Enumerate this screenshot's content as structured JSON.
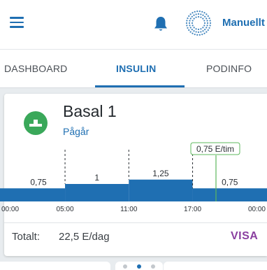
{
  "header": {
    "menu_icon": "hamburger-menu-icon",
    "notification_icon": "bell-icon",
    "mode_icon": "manual-mode-ring-icon",
    "mode_label": "Manuellt"
  },
  "tabs": [
    {
      "label": "DASHBOARD",
      "active": false
    },
    {
      "label": "INSULIN",
      "active": true
    },
    {
      "label": "PODINFO",
      "active": false
    }
  ],
  "basal": {
    "icon": "basal-program-icon",
    "title": "Basal 1",
    "status": "Pågår",
    "current_rate_label": "0,75 E/tim",
    "total_label": "Totalt:",
    "total_value": "22,5 E/dag",
    "view_label": "VISA"
  },
  "chart_data": {
    "type": "step-area",
    "unit": "E/tim",
    "x_tick_labels": [
      "00:00",
      "05:00",
      "11:00",
      "17:00",
      "00:00"
    ],
    "segments": [
      {
        "start": "00:00",
        "end": "05:00",
        "value": 0.75,
        "label": "0,75"
      },
      {
        "start": "05:00",
        "end": "11:00",
        "value": 1,
        "label": "1"
      },
      {
        "start": "11:00",
        "end": "17:00",
        "value": 1.25,
        "label": "1,25"
      },
      {
        "start": "17:00",
        "end": "24:00",
        "value": 0.75,
        "label": "0,75"
      }
    ],
    "current_time_hours": 19.2,
    "current_rate": 0.75
  },
  "pager": {
    "count": 3,
    "active_index": 1
  },
  "colors": {
    "primary": "#1f6fb2",
    "bar": "#1f6fb2",
    "basal_icon_green": "#3aa85a",
    "current_marker": "#5cb85c",
    "view_link": "#8a3fa0"
  }
}
